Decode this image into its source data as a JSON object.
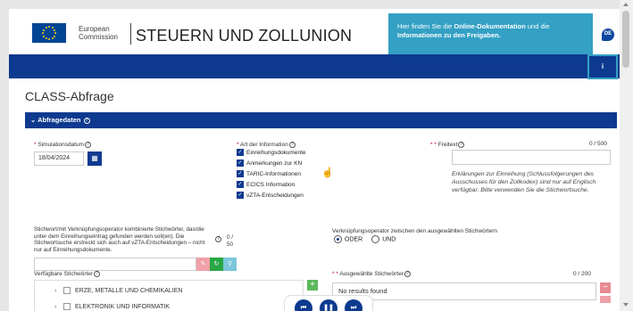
{
  "header": {
    "logo_line1": "European",
    "logo_line2": "Commission",
    "site_title": "STEUERN UND ZOLLUNION",
    "banner_pre": "Hier finden Sie die ",
    "banner_bold1": "Online-Dokumentation",
    "banner_mid": " und die ",
    "banner_bold2": "Informationen zu den Freigaben.",
    "lang": "DE",
    "info_icon": "i"
  },
  "page_title": "CLASS-Abfrage",
  "panel": {
    "title": "Abfragedaten",
    "chevron_icon": "chevron-down-icon",
    "help_glyph": "?"
  },
  "simulation": {
    "label": "Simulationsdatum",
    "value": "18/04/2024",
    "calendar_icon": "calendar-icon"
  },
  "info_type": {
    "label": "Art der Information",
    "items": [
      {
        "label": "Einreihungsdokumente",
        "checked": true
      },
      {
        "label": "Anmerkungen zur KN",
        "checked": true
      },
      {
        "label": "TARIC-Informationen",
        "checked": true
      },
      {
        "label": "ECICS Information",
        "checked": true
      },
      {
        "label": "vZTA-Entscheidungen",
        "checked": true
      }
    ]
  },
  "freitext": {
    "label": "Freitext",
    "counter": "0 / 500",
    "hint": "Erklärungen zur Einreihung (Schlussfolgerungen des Ausschusses für den Zollkodex) sind nur auf Englisch verfügbar. Bitte verwenden Sie die Stichwortsuche."
  },
  "keywords": {
    "label": "Stichwort/mit Verknüpfungsoperator kombinierte Stichwörter, das/die unter dem Einreihungseintrag gefunden werden soll(en). Die Stichwortsuche erstreckt sich auch auf vZTA-Entscheidungen – nicht nur auf Einreihungsdokumente.",
    "counter_top": "0 /",
    "counter_bottom": "50"
  },
  "operator": {
    "label": "Verknüpfungsoperator zwischen den ausgewählten Stichwörtern",
    "options": [
      {
        "label": "ODER",
        "selected": true
      },
      {
        "label": "UND",
        "selected": false
      }
    ]
  },
  "available": {
    "label": "Verfügbare Stichwörter",
    "items": [
      {
        "label": "ERZE, METALLE UND CHEMIKALIEN"
      },
      {
        "label": "ELEKTRONIK UND INFORMATIK"
      }
    ]
  },
  "selected": {
    "label": "Ausgewählte Stichwörter",
    "counter": "0 / 200",
    "empty_text": "No results found"
  },
  "colors": {
    "brand_blue": "#0d3a8f",
    "banner": "#33a0c4",
    "required": "#d0021b"
  }
}
